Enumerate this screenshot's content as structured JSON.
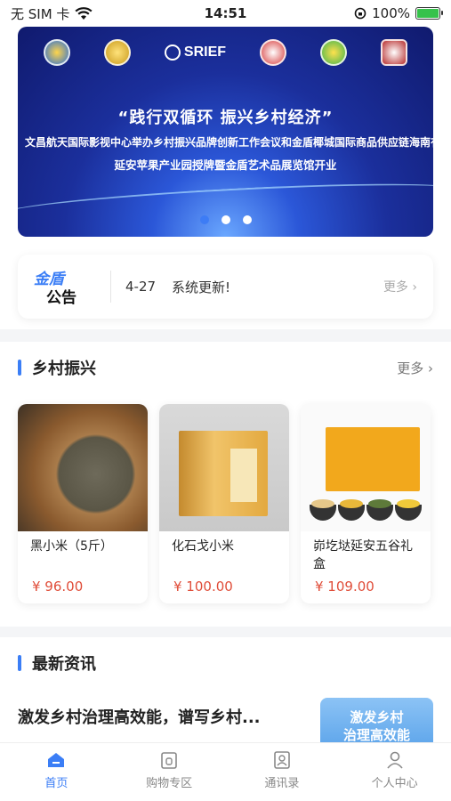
{
  "status_bar": {
    "carrier": "无 SIM 卡",
    "time": "14:51",
    "battery": "100%"
  },
  "banner": {
    "logo_text": "SRIEF",
    "title": "“践行双循环  振兴乡村经济”",
    "subtitle_1": "文昌航天国际影视中心举办乡村振兴品牌创新工作会议和金盾椰城国际商品供应链海南有限公司为",
    "subtitle_2": "延安苹果产业园授牌暨金盾艺术品展览馆开业",
    "slide_count": 3,
    "active_slide": 1
  },
  "notice": {
    "logo_top": "金盾",
    "logo_bottom": "公告",
    "date": "4-27",
    "text": "系统更新!",
    "more": "更多"
  },
  "rural": {
    "title": "乡村振兴",
    "more": "更多",
    "products": [
      {
        "name": "黑小米（5斤）",
        "price": "¥ 96.00"
      },
      {
        "name": "化石戈小米",
        "price": "¥ 100.00"
      },
      {
        "name": "峁圪垯延安五谷礼盒",
        "price": "¥ 109.00"
      }
    ]
  },
  "news": {
    "title": "最新资讯",
    "headline": "激发乡村治理高效能，谱写乡村...",
    "thumb_text": "激发乡村\n治理高效能"
  },
  "tabbar": {
    "items": [
      {
        "label": "首页",
        "icon": "home-icon"
      },
      {
        "label": "购物专区",
        "icon": "shop-icon"
      },
      {
        "label": "通讯录",
        "icon": "contacts-icon"
      },
      {
        "label": "个人中心",
        "icon": "user-icon"
      }
    ],
    "active_index": 0
  },
  "colors": {
    "accent": "#3b7ef6",
    "price": "#e04e3a"
  }
}
